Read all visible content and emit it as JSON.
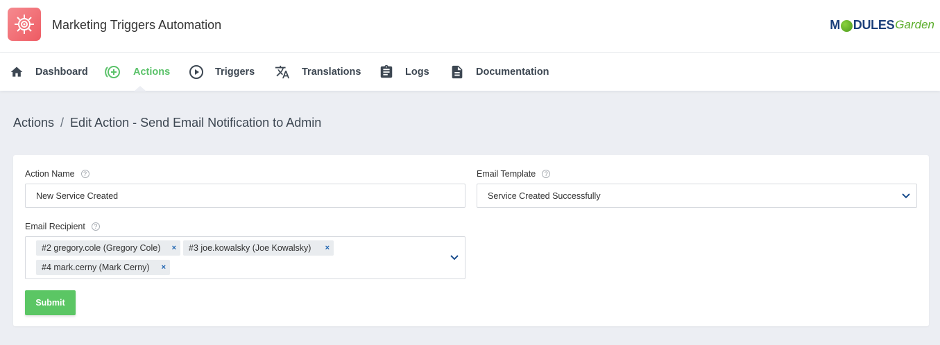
{
  "header": {
    "app_title": "Marketing Triggers Automation",
    "brand_m": "M",
    "brand_dules": "DULES",
    "brand_garden": "Garden"
  },
  "nav": {
    "items": [
      {
        "label": "Dashboard",
        "icon": "home-icon"
      },
      {
        "label": "Actions",
        "icon": "add-circle-icon",
        "active": true
      },
      {
        "label": "Triggers",
        "icon": "play-circle-icon"
      },
      {
        "label": "Translations",
        "icon": "translate-icon"
      },
      {
        "label": "Logs",
        "icon": "clipboard-icon"
      },
      {
        "label": "Documentation",
        "icon": "document-icon"
      }
    ]
  },
  "breadcrumb": {
    "root": "Actions",
    "separator": "/",
    "current": "Edit Action - Send Email Notification to Admin"
  },
  "form": {
    "action_name_label": "Action Name",
    "action_name_value": "New Service Created",
    "email_template_label": "Email Template",
    "email_template_value": "Service Created Successfully",
    "email_recipient_label": "Email Recipient",
    "recipients": [
      "#2 gregory.cole (Gregory Cole)",
      "#3 joe.kowalsky (Joe Kowalsky)",
      "#4 mark.cerny (Mark Cerny)"
    ],
    "remove_symbol": "×",
    "help_symbol": "?",
    "submit_label": "Submit"
  },
  "colors": {
    "accent": "#5bc26a",
    "logo": "#ee5b63",
    "text": "#3d4752"
  }
}
